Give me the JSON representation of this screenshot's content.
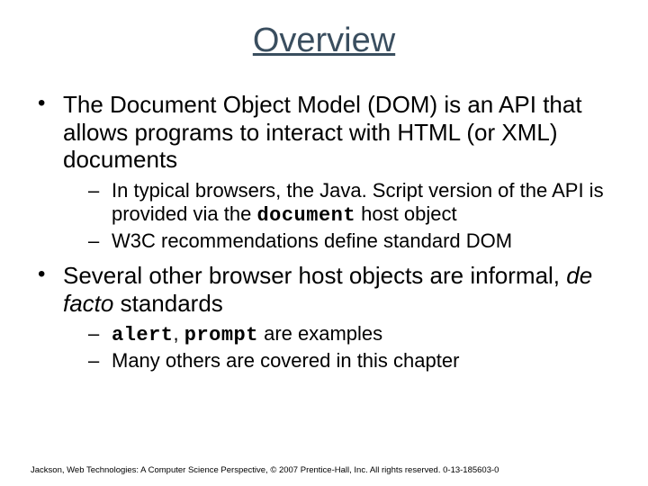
{
  "title": "Overview",
  "bullets": [
    {
      "text_parts": [
        "The Document Object Model (DOM) is an API that allows programs to interact with HTML (or XML) documents"
      ],
      "sub": [
        {
          "pre": "In typical browsers, the Java. Script version of the API is provided via the ",
          "code": "document",
          "post": " host object"
        },
        {
          "pre": "W3C recommendations define standard DOM",
          "code": "",
          "post": ""
        }
      ]
    },
    {
      "text_parts": [
        "Several other browser host objects are informal, ",
        "de facto",
        " standards"
      ],
      "sub": [
        {
          "pre": "",
          "code": "alert",
          "mid": ", ",
          "code2": "prompt",
          "post": " are examples"
        },
        {
          "pre": "Many others are covered in this chapter",
          "code": "",
          "post": ""
        }
      ]
    }
  ],
  "footer": "Jackson, Web Technologies: A Computer Science Perspective, © 2007 Prentice-Hall, Inc. All rights reserved. 0-13-185603-0"
}
